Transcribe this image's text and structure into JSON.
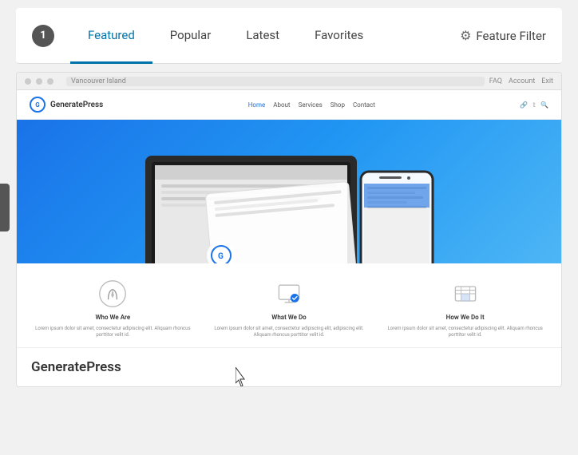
{
  "tab_bar": {
    "number": "1",
    "tabs": [
      {
        "id": "featured",
        "label": "Featured",
        "active": true
      },
      {
        "id": "popular",
        "label": "Popular",
        "active": false
      },
      {
        "id": "latest",
        "label": "Latest",
        "active": false
      },
      {
        "id": "favorites",
        "label": "Favorites",
        "active": false
      }
    ],
    "feature_filter_label": "Feature Filter"
  },
  "theme": {
    "name": "GeneratePress",
    "browser_url": "Vancouver Island",
    "browser_links": [
      "FAQ",
      "Account",
      "Exit"
    ],
    "nav_items": [
      "Home",
      "About",
      "Services",
      "Shop",
      "Contact"
    ],
    "hero_alt": "Hero banner with device mockups",
    "features": [
      {
        "id": "who",
        "title": "Who We Are",
        "text": "Lorem ipsum dolor sit amet, consectetur adipiscing elit. Aliquam rhoncus porttitor velit id."
      },
      {
        "id": "what",
        "title": "What We Do",
        "text": "Lorem ipsum dolor sit amet, consectetur adipiscing elit, adipiscing elit. Aliquam rhoncus porttitor velit id."
      },
      {
        "id": "how",
        "title": "How We Do It",
        "text": "Lorem ipsum dolor sit amet, consectetur adipiscing elit. Aliquam rhoncus porttitor velit id."
      }
    ]
  },
  "colors": {
    "active_tab": "#0073aa",
    "hero_blue": "#1a73e8",
    "tab_number_bg": "#555"
  }
}
